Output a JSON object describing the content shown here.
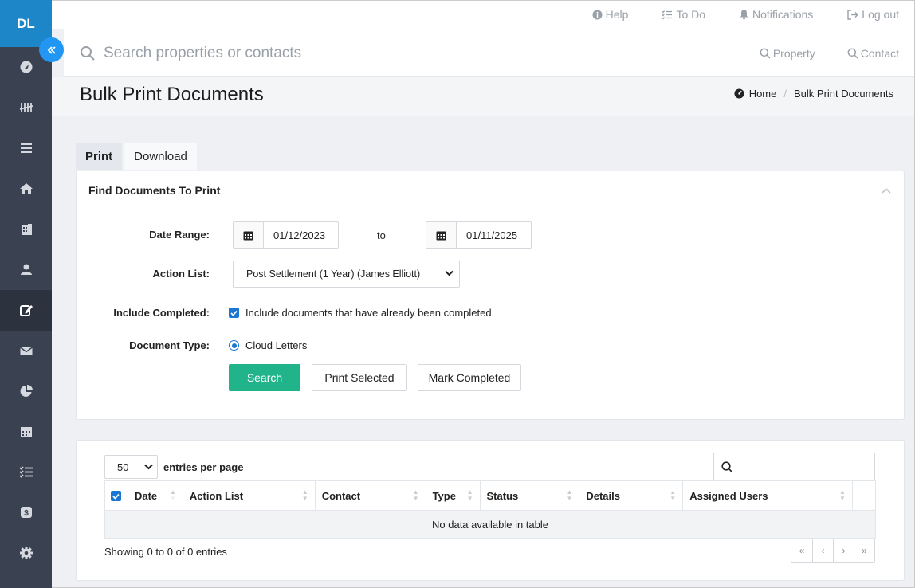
{
  "user_initials": "DL",
  "topbar": {
    "help": "Help",
    "todo": "To Do",
    "notifications": "Notifications",
    "logout": "Log out"
  },
  "search": {
    "placeholder": "Search properties or contacts",
    "property": "Property",
    "contact": "Contact"
  },
  "page": {
    "title": "Bulk Print Documents",
    "breadcrumb": [
      "Home",
      "Bulk Print Documents"
    ]
  },
  "tabs": [
    "Print",
    "Download"
  ],
  "form": {
    "card_title": "Find Documents To Print",
    "date_range_label": "Date Range:",
    "date_from": "01/12/2023",
    "to_label": "to",
    "date_to": "01/11/2025",
    "action_list_label": "Action List:",
    "action_list_value": "Post Settlement (1 Year) (James Elliott)",
    "include_completed_label": "Include Completed:",
    "include_completed_text": "Include documents that have already been completed",
    "document_type_label": "Document Type:",
    "document_type_value": "Cloud Letters",
    "search_btn": "Search",
    "print_btn": "Print Selected",
    "mark_btn": "Mark Completed"
  },
  "table": {
    "per_page_value": "50",
    "per_page_label": "entries per page",
    "columns": [
      "Date",
      "Action List",
      "Contact",
      "Type",
      "Status",
      "Details",
      "Assigned Users"
    ],
    "empty": "No data available in table",
    "showing": "Showing 0 to 0 of 0 entries",
    "pager": [
      "«",
      "‹",
      "›",
      "»"
    ]
  },
  "colors": {
    "sidebar": "#3a4150",
    "accent": "#1c86c8",
    "primary_button": "#21b38a"
  }
}
